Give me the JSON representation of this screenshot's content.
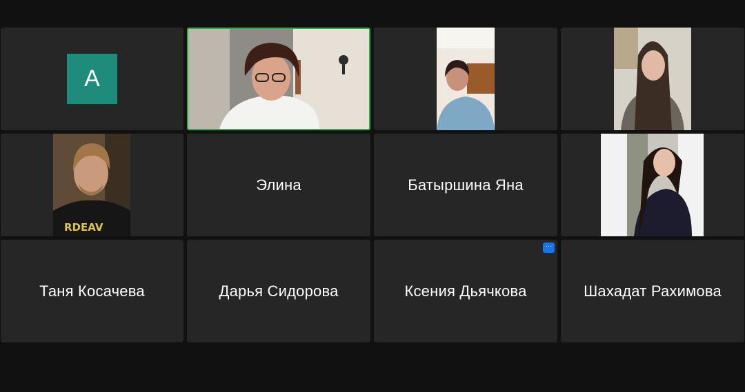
{
  "colors": {
    "background": "#111111",
    "tile": "#262626",
    "active_speaker_border": "#23b14d",
    "avatar": "#1f8b7a",
    "more_badge": "#1a73e8"
  },
  "participants": [
    {
      "avatar_letter": "A"
    },
    {
      "name": "Элина"
    },
    {
      "name": "Батыршина Яна"
    },
    {
      "name": "Таня Косачева"
    },
    {
      "name": "Дарья Сидорова"
    },
    {
      "name": "Ксения Дьячкова",
      "more_icon": "more-options-icon",
      "more_glyph": "···"
    },
    {
      "name": "Шахадат Рахимова"
    }
  ]
}
